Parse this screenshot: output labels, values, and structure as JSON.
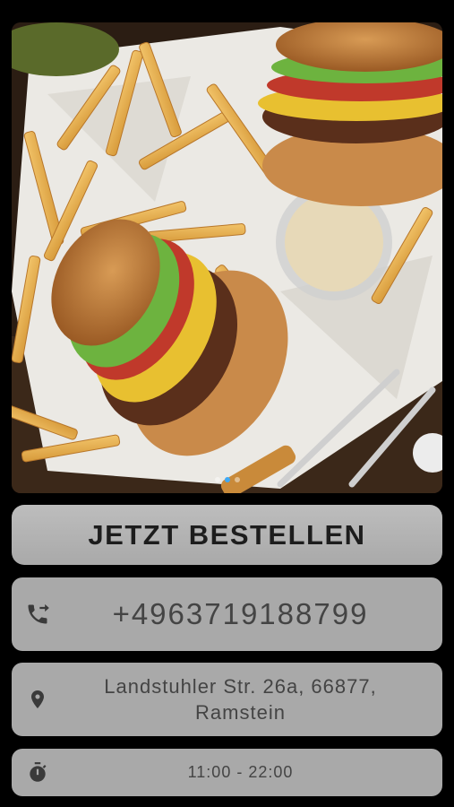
{
  "carousel": {
    "image_alt": "burger-and-fries-photo",
    "slide_count": 3,
    "active_index": 1
  },
  "order_button": {
    "label": "JETZT BESTELLEN"
  },
  "contact": {
    "phone": "+4963719188799",
    "phone_icon": "phone-forward-icon",
    "address": "Landstuhler Str. 26a, 66877, Ramstein",
    "address_icon": "location-pin-icon",
    "hours": "11:00 - 22:00",
    "hours_icon": "stopwatch-icon"
  },
  "colors": {
    "background": "#000000",
    "button": "#b3b3b3",
    "info_box": "#a9a9a9",
    "active_dot": "#3fa9f5"
  }
}
